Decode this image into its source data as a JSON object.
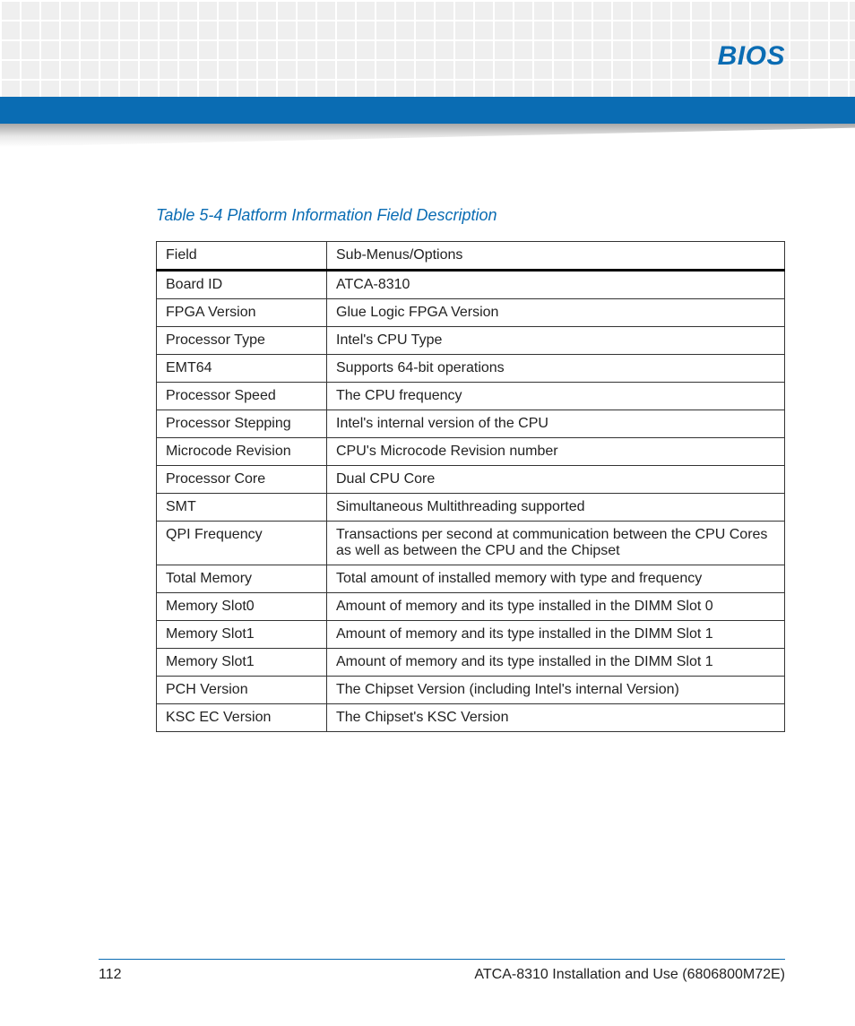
{
  "header": {
    "section_title": "BIOS"
  },
  "table": {
    "caption": "Table 5-4 Platform Information Field Description",
    "columns": {
      "field": "Field",
      "options": "Sub-Menus/Options"
    },
    "rows": [
      {
        "field": "Board ID",
        "options": "ATCA-8310"
      },
      {
        "field": "FPGA Version",
        "options": "Glue Logic FPGA Version"
      },
      {
        "field": "Processor Type",
        "options": "Intel's CPU Type"
      },
      {
        "field": "EMT64",
        "options": "Supports 64-bit operations"
      },
      {
        "field": "Processor Speed",
        "options": "The CPU frequency"
      },
      {
        "field": "Processor Stepping",
        "options": "Intel's internal version of the CPU"
      },
      {
        "field": "Microcode Revision",
        "options": "CPU's Microcode Revision number"
      },
      {
        "field": "Processor Core",
        "options": "Dual CPU Core"
      },
      {
        "field": "SMT",
        "options": "Simultaneous Multithreading supported"
      },
      {
        "field": "QPI Frequency",
        "options": "Transactions per second at communication between the CPU Cores as well as between the CPU and the Chipset"
      },
      {
        "field": "Total Memory",
        "options": "Total amount of installed memory with type and frequency"
      },
      {
        "field": "Memory Slot0",
        "options": "Amount of memory and its type installed in the DIMM Slot 0"
      },
      {
        "field": "Memory Slot1",
        "options": "Amount of memory and its type installed in the DIMM Slot 1"
      },
      {
        "field": "Memory Slot1",
        "options": "Amount of memory and its type installed in the DIMM Slot 1"
      },
      {
        "field": "PCH Version",
        "options": "The Chipset Version (including Intel's internal Version)"
      },
      {
        "field": "KSC EC Version",
        "options": "The Chipset's KSC Version"
      }
    ]
  },
  "footer": {
    "page_number": "112",
    "doc_title": "ATCA-8310 Installation and Use (6806800M72E)"
  }
}
